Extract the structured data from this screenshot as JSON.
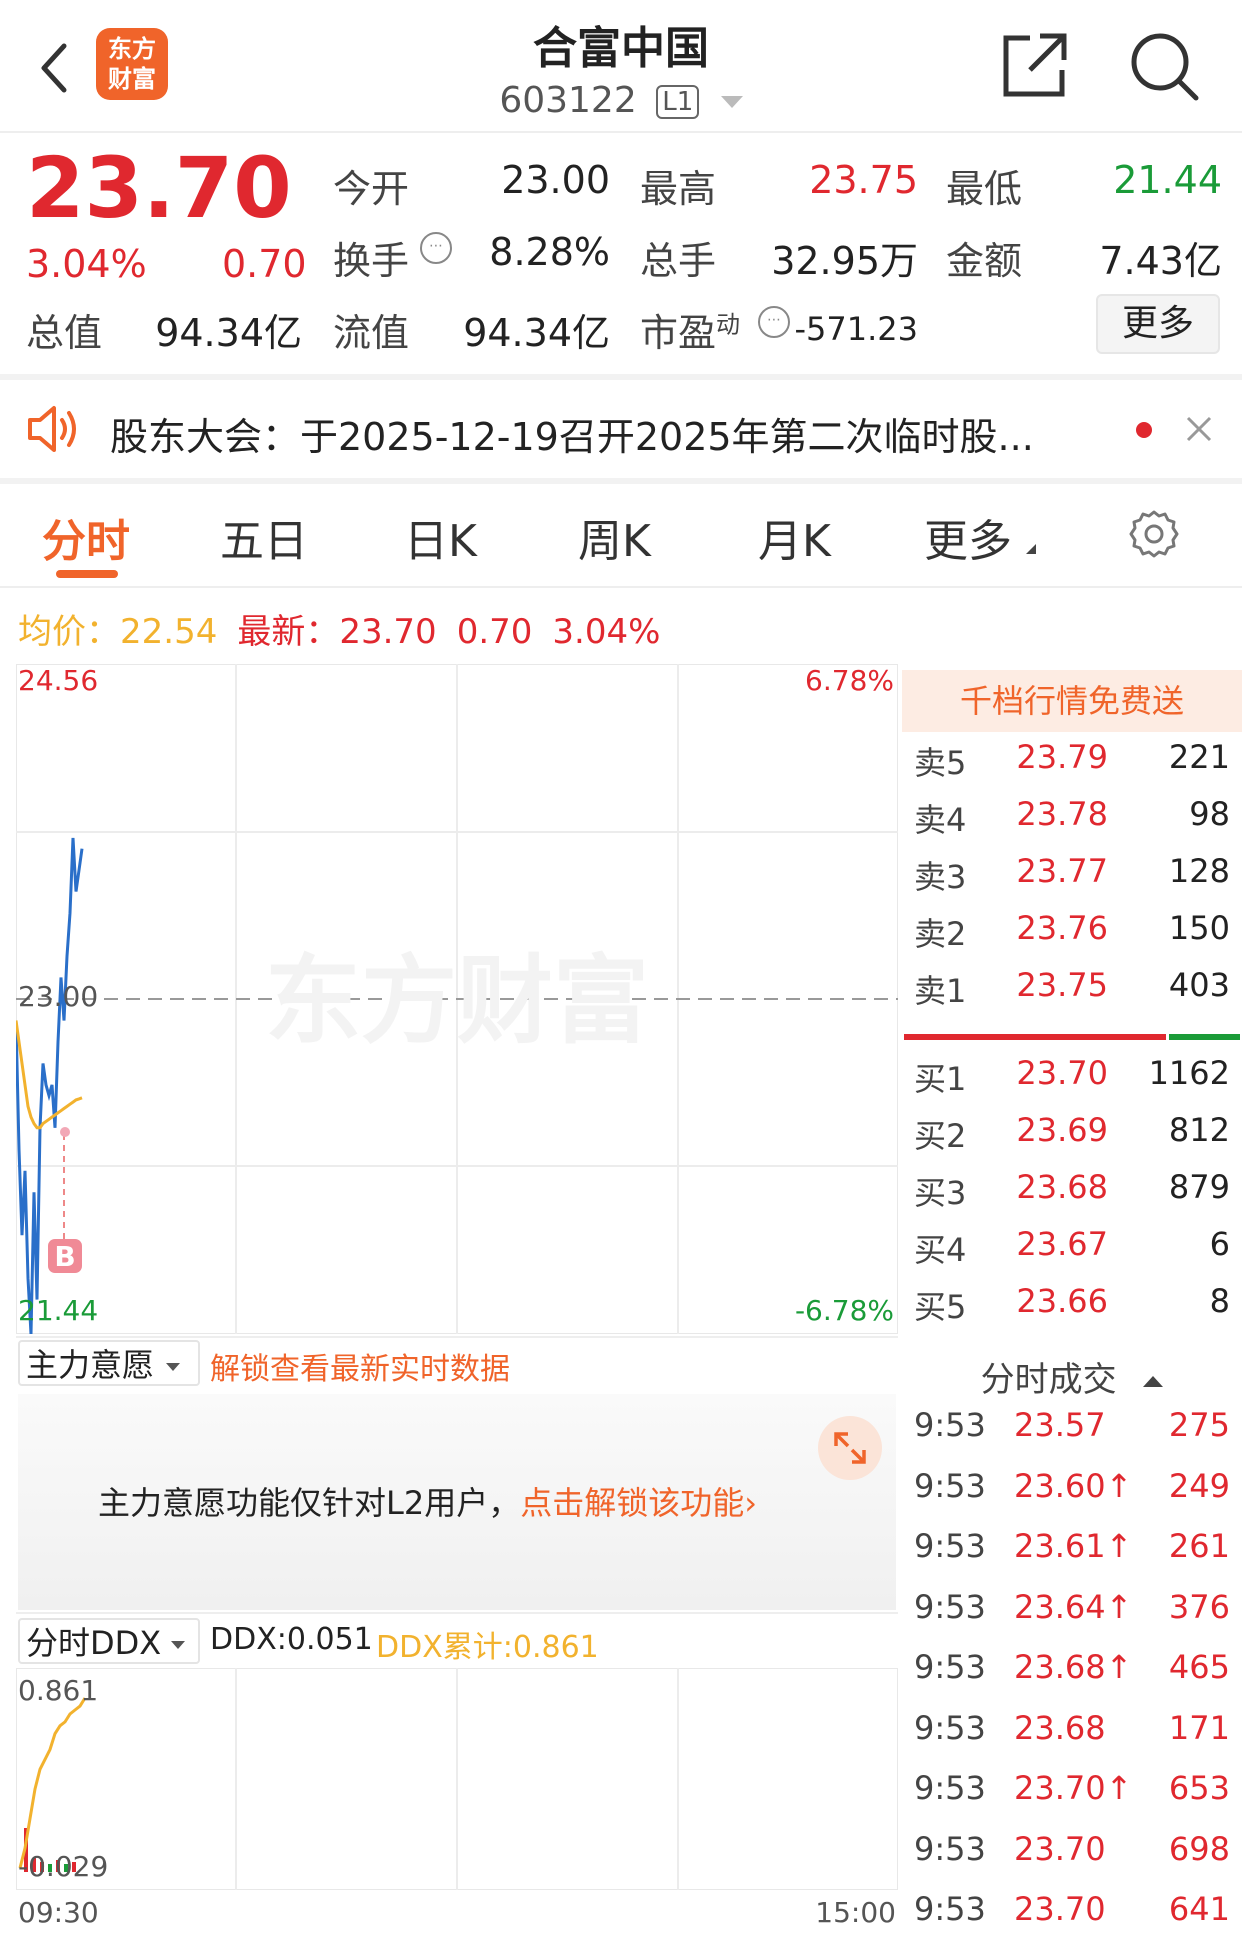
{
  "header": {
    "title": "合富中国",
    "code": "603122",
    "level_badge": "L1",
    "logo_line1": "东方",
    "logo_line2": "财富",
    "icons": [
      "back-icon",
      "share-icon",
      "search-icon"
    ]
  },
  "quote": {
    "price": "23.70",
    "change_pct": "3.04%",
    "change": "0.70",
    "fields": [
      {
        "label": "今开",
        "value": "23.00"
      },
      {
        "label": "最高",
        "value": "23.75"
      },
      {
        "label": "最低",
        "value": "21.44"
      },
      {
        "label": "换手",
        "value": "8.28%"
      },
      {
        "label": "总手",
        "value": "32.95万"
      },
      {
        "label": "金额",
        "value": "7.43亿"
      },
      {
        "label": "总值",
        "value": "94.34亿"
      },
      {
        "label": "流值",
        "value": "94.34亿"
      },
      {
        "label": "市盈",
        "value": "-571.23"
      }
    ],
    "pe_superscript": "动",
    "more_button": "更多"
  },
  "notice": {
    "text": "股东大会：于2025-12-19召开2025年第二次临时股..."
  },
  "tabs": [
    "分时",
    "五日",
    "日K",
    "周K",
    "月K",
    "更多"
  ],
  "chart_header": {
    "avg_label": "均价：",
    "avg_value": "22.54",
    "latest_label": "最新：",
    "latest_value": "23.70",
    "latest_change": "0.70",
    "latest_pct": "3.04%"
  },
  "chart_labels": {
    "top_price": "24.56",
    "top_pct": "6.78%",
    "mid_price": "23.00",
    "bottom_price": "21.44",
    "bottom_pct": "-6.78%",
    "buy_marker": "B",
    "watermark": "东方财富"
  },
  "chart_data": {
    "type": "line",
    "title": "",
    "x_range": [
      "09:30",
      "15:00"
    ],
    "ylim": [
      21.44,
      24.56
    ],
    "reference_price": 23.0,
    "series": [
      {
        "values": [
          22.9,
          22.3,
          21.9,
          22.2,
          21.7,
          21.44,
          22.1,
          21.6,
          22.4,
          22.7,
          22.6,
          22.55,
          22.6,
          22.4,
          22.8,
          23.1,
          22.9,
          23.2,
          23.4,
          23.75,
          23.5,
          23.6,
          23.7
        ]
      },
      {
        "values": [
          22.9,
          22.8,
          22.7,
          22.6,
          22.5,
          22.45,
          22.42,
          22.4,
          22.4,
          22.42,
          22.43,
          22.44,
          22.45,
          22.46,
          22.47,
          22.48,
          22.49,
          22.5,
          22.51,
          22.52,
          22.53,
          22.535,
          22.54
        ]
      }
    ]
  },
  "orderbook": {
    "banner": "千档行情免费送",
    "asks": [
      {
        "label": "卖5",
        "price": "23.79",
        "vol": "221"
      },
      {
        "label": "卖4",
        "price": "23.78",
        "vol": "98"
      },
      {
        "label": "卖3",
        "price": "23.77",
        "vol": "128"
      },
      {
        "label": "卖2",
        "price": "23.76",
        "vol": "150"
      },
      {
        "label": "卖1",
        "price": "23.75",
        "vol": "403"
      }
    ],
    "bids": [
      {
        "label": "买1",
        "price": "23.70",
        "vol": "1162"
      },
      {
        "label": "买2",
        "price": "23.69",
        "vol": "812"
      },
      {
        "label": "买3",
        "price": "23.68",
        "vol": "879"
      },
      {
        "label": "买4",
        "price": "23.67",
        "vol": "6"
      },
      {
        "label": "买5",
        "price": "23.66",
        "vol": "8"
      }
    ],
    "buy_ratio": 0.78
  },
  "trades": {
    "title": "分时成交",
    "rows": [
      {
        "time": "9:53",
        "price": "23.57",
        "vol": "275"
      },
      {
        "time": "9:53",
        "price": "23.60↑",
        "vol": "249"
      },
      {
        "time": "9:53",
        "price": "23.61↑",
        "vol": "261"
      },
      {
        "time": "9:53",
        "price": "23.64↑",
        "vol": "376"
      },
      {
        "time": "9:53",
        "price": "23.68↑",
        "vol": "465"
      },
      {
        "time": "9:53",
        "price": "23.68",
        "vol": "171"
      },
      {
        "time": "9:53",
        "price": "23.70↑",
        "vol": "653"
      },
      {
        "time": "9:53",
        "price": "23.70",
        "vol": "698"
      },
      {
        "time": "9:53",
        "price": "23.70",
        "vol": "641"
      }
    ]
  },
  "main_force": {
    "selector": "主力意愿",
    "unlock_link": "解锁查看最新实时数据",
    "info_text": "主力意愿功能仅针对L2用户，",
    "info_link": "点击解锁该功能"
  },
  "ddx": {
    "selector": "分时DDX",
    "ddx_label": "DDX:0.051",
    "ddx_cum": "DDX累计:0.861",
    "top_value": "0.861",
    "bottom_value": "-0.029",
    "time_start": "09:30",
    "time_end": "15:00",
    "ddx_series": [
      0.0,
      0.1,
      0.25,
      0.4,
      0.5,
      0.55,
      0.6,
      0.68,
      0.72,
      0.74,
      0.78,
      0.8,
      0.82,
      0.861
    ]
  },
  "colors": {
    "up": "#e0282f",
    "down": "#1a9b38",
    "accent": "#f0642a",
    "price_line": "#2a6fc9",
    "avg_line": "#f2b22e"
  }
}
